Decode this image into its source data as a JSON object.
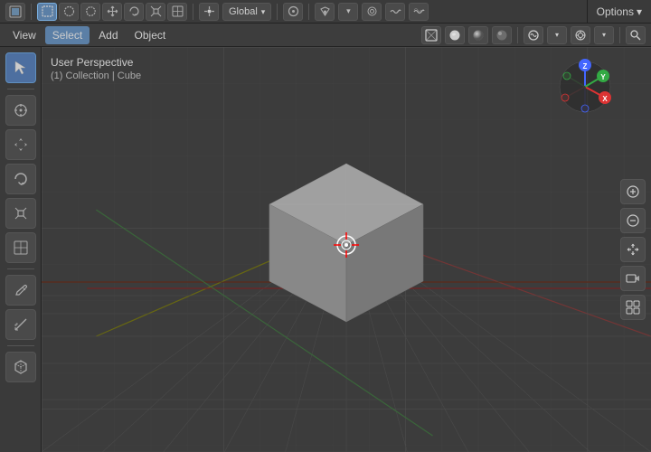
{
  "app": {
    "options_label": "Options",
    "options_chevron": "▾"
  },
  "top_toolbar": {
    "transform_modes": [
      "object_mode_icon"
    ],
    "global_label": "Global",
    "snap_icon": "magnet",
    "proportional_icon": "circle",
    "search_icon": "search"
  },
  "menu_bar": {
    "items": [
      {
        "id": "view",
        "label": "View"
      },
      {
        "id": "select",
        "label": "Select"
      },
      {
        "id": "add",
        "label": "Add"
      },
      {
        "id": "object",
        "label": "Object"
      }
    ]
  },
  "viewport": {
    "title": "User Perspective",
    "subtitle": "(1) Collection | Cube"
  },
  "left_tools": [
    {
      "id": "select",
      "label": "Select",
      "icon": "cursor",
      "active": true
    },
    {
      "id": "cursor",
      "label": "Cursor",
      "icon": "crosshair"
    },
    {
      "id": "move",
      "label": "Move",
      "icon": "move"
    },
    {
      "id": "rotate",
      "label": "Rotate",
      "icon": "rotate"
    },
    {
      "id": "scale",
      "label": "Scale",
      "icon": "scale"
    },
    {
      "id": "transform",
      "label": "Transform",
      "icon": "transform"
    },
    {
      "id": "annotate",
      "label": "Annotate",
      "icon": "annotate"
    },
    {
      "id": "measure",
      "label": "Measure",
      "icon": "measure"
    },
    {
      "id": "add_cube",
      "label": "Add Cube",
      "icon": "cube_add"
    }
  ],
  "axis_gizmo": {
    "x_color": "#e44",
    "y_color": "#8c8",
    "z_color": "#55f",
    "x_label": "X",
    "y_label": "Y",
    "z_label": "Z"
  },
  "right_controls": [
    {
      "id": "zoom_in",
      "icon": "+"
    },
    {
      "id": "zoom_out",
      "icon": "−"
    },
    {
      "id": "hand",
      "icon": "✋"
    },
    {
      "id": "camera",
      "icon": "📷"
    },
    {
      "id": "grid_view",
      "icon": "⊞"
    }
  ],
  "cube": {
    "color_top": "#a0a0a0",
    "color_front": "#888888",
    "color_right": "#787878"
  }
}
